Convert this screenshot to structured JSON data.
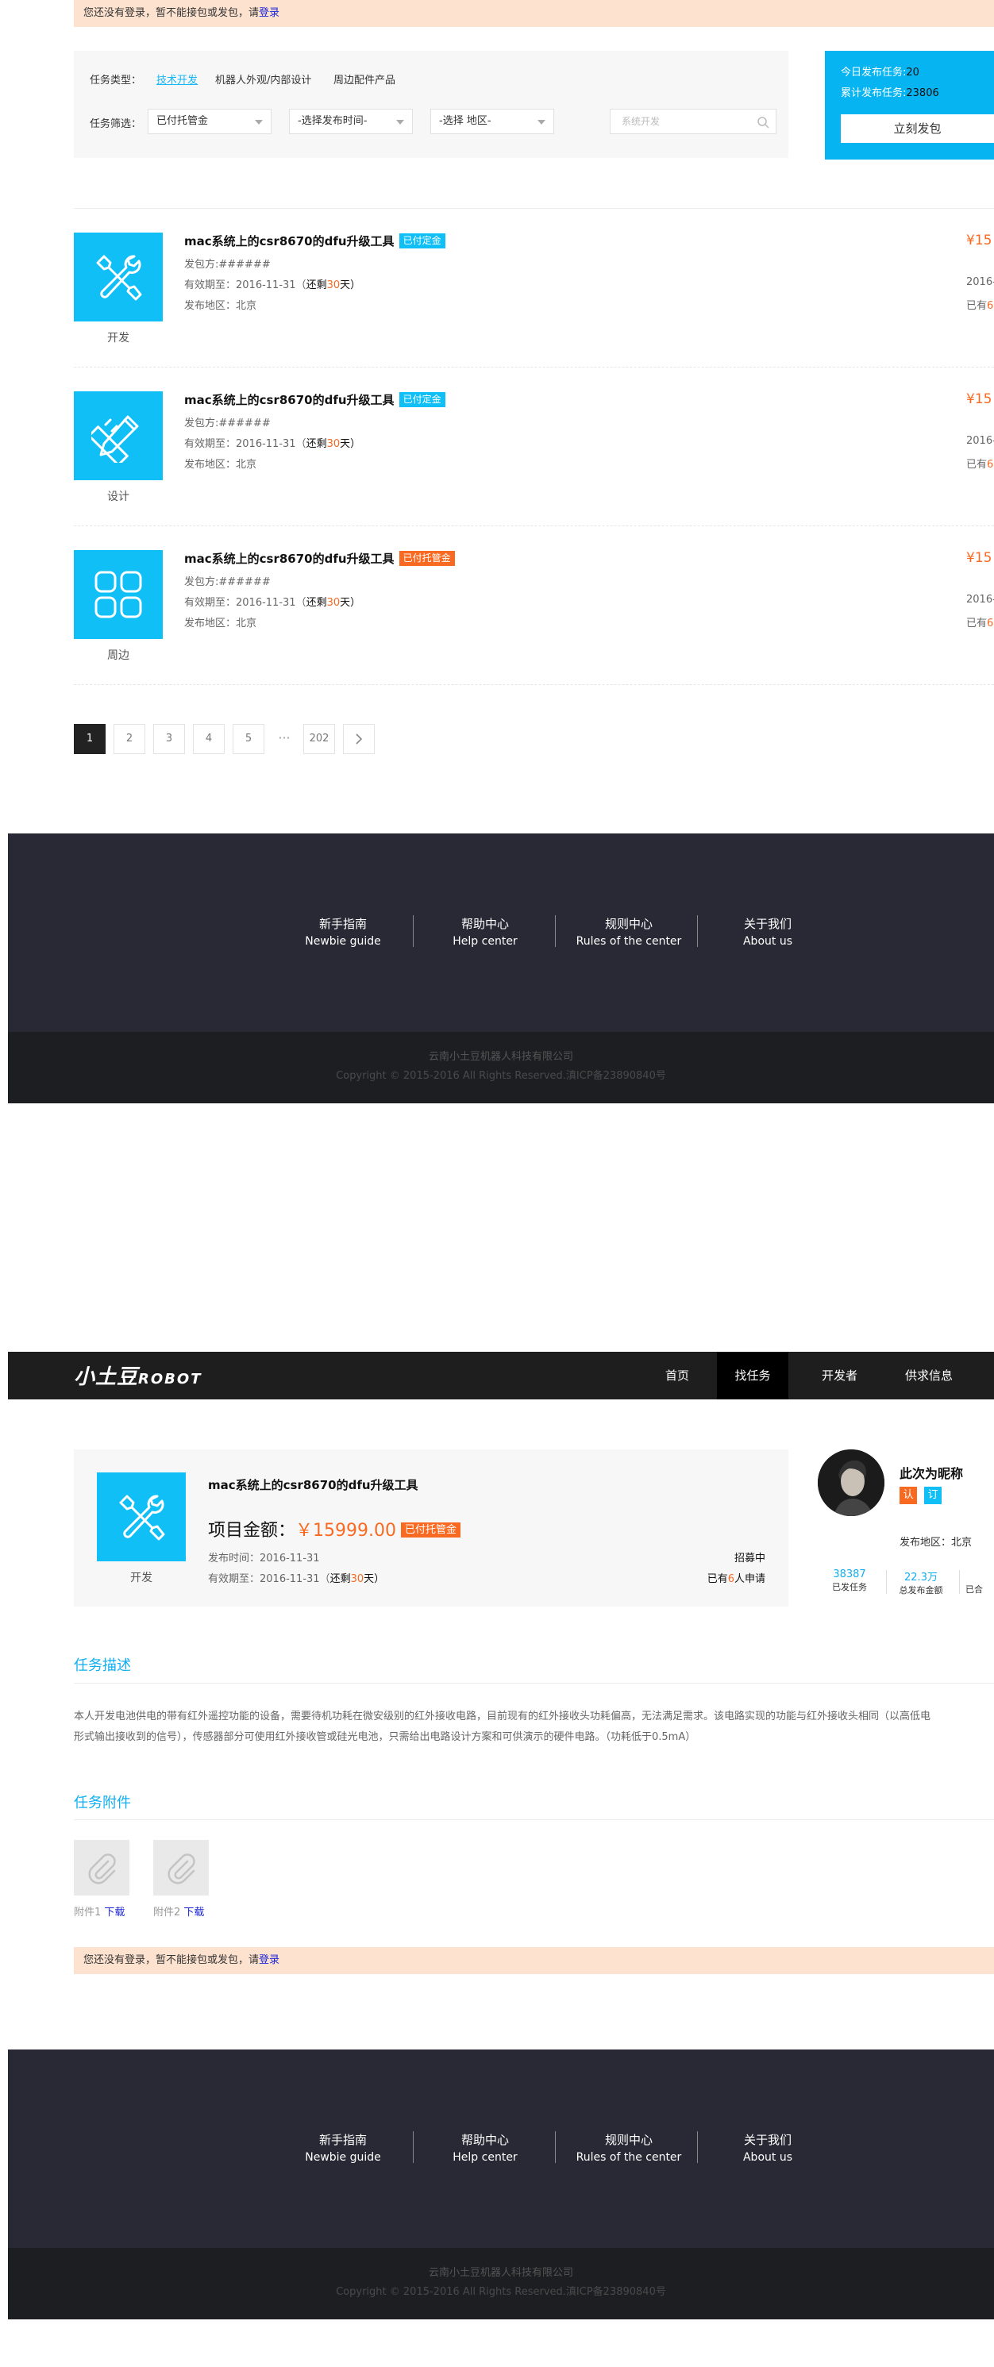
{
  "notice": {
    "text": "您还没有登录，暂不能接包或发包，请",
    "link": "登录"
  },
  "filter": {
    "type_label": "任务类型：",
    "types": [
      "技术开发",
      "机器人外观/内部设计",
      "周边配件产品"
    ],
    "filter_label": "任务筛选：",
    "selects": [
      "已付托管金",
      "-选择发布时间-",
      "-选择 地区-"
    ],
    "search_placeholder": "系统开发"
  },
  "stats": {
    "today_label": "今日发布任务:",
    "today_value": "20",
    "total_label": "累计发布任务:",
    "total_value": "23806",
    "publish_button": "立刻发包"
  },
  "tasks": [
    {
      "icon": "tools-icon",
      "category": "开发",
      "title": "mac系统上的csr8670的dfu升级工具",
      "badge": "已付定金",
      "badge_color": "#10bff5",
      "publisher": "发包方:######",
      "valid_prefix": "有效期至：2016-11-31（",
      "valid_remain": "还剩",
      "valid_days": "30",
      "valid_suffix": "天）",
      "region": "发布地区：北京",
      "price": "¥15",
      "date": "2016-",
      "applied_prefix": "已有",
      "applied_count": "6"
    },
    {
      "icon": "design-icon",
      "category": "设计",
      "title": "mac系统上的csr8670的dfu升级工具",
      "badge": "已付定金",
      "badge_color": "#10bff5",
      "publisher": "发包方:######",
      "valid_prefix": "有效期至：2016-11-31（",
      "valid_remain": "还剩",
      "valid_days": "30",
      "valid_suffix": "天）",
      "region": "发布地区：北京",
      "price": "¥15",
      "date": "2016-",
      "applied_prefix": "已有",
      "applied_count": "6"
    },
    {
      "icon": "grid-icon",
      "category": "周边",
      "title": "mac系统上的csr8670的dfu升级工具",
      "badge": "已付托管金",
      "badge_color": "#f86a22",
      "publisher": "发包方:######",
      "valid_prefix": "有效期至：2016-11-31（",
      "valid_remain": "还剩",
      "valid_days": "30",
      "valid_suffix": "天）",
      "region": "发布地区：北京",
      "price": "¥15",
      "date": "2016-",
      "applied_prefix": "已有",
      "applied_count": "6"
    }
  ],
  "pagination": {
    "pages": [
      "1",
      "2",
      "3",
      "4",
      "5"
    ],
    "dots": "···",
    "last": "202",
    "active": "1"
  },
  "footer": {
    "links": [
      {
        "cn": "新手指南",
        "en": "Newbie guide"
      },
      {
        "cn": "帮助中心",
        "en": "Help center"
      },
      {
        "cn": "规则中心",
        "en": "Rules of the center"
      },
      {
        "cn": "关于我们",
        "en": "About us"
      }
    ],
    "company": "云南小土豆机器人科技有限公司",
    "copyright": "Copyright © 2015-2016  All Rights Reserved.滇ICP备23890840号"
  },
  "nav": {
    "logo_cn": "小土豆",
    "logo_en": "ROBOT",
    "items": [
      "首页",
      "找任务",
      "开发者",
      "供求信息"
    ],
    "active": "找任务"
  },
  "detail": {
    "category": "开发",
    "title": "mac系统上的csr8670的dfu升级工具",
    "amount_label": "项目金额：",
    "amount": "￥15999.00",
    "badge": "已付托管金",
    "publish_time": "发布时间：2016-11-31",
    "valid_prefix": "有效期至：2016-11-31（",
    "valid_remain": "还剩",
    "valid_days": "30",
    "valid_suffix": "天）",
    "status": "招募中",
    "applied_prefix": "已有",
    "applied_count": "6",
    "applied_suffix": "人申请"
  },
  "user": {
    "nickname": "此次为昵称",
    "cert1": "认",
    "cert1_color": "#f86a22",
    "cert2": "订",
    "cert2_color": "#10bff5",
    "region": "发布地区：北京",
    "stats": [
      {
        "value": "38387",
        "label": "已发任务"
      },
      {
        "value": "22.3万",
        "label": "总发布金额"
      },
      {
        "value": "",
        "label": "已合"
      }
    ]
  },
  "description": {
    "title": "任务描述",
    "line1": "本人开发电池供电的带有红外遥控功能的设备，需要待机功耗在微安级别的红外接收电路，目前现有的红外接收头功耗偏高，无法满足需求。该电路实现的功能与红外接收头相同（以高低电",
    "line2": "形式输出接收到的信号），传感器部分可使用红外接收管或硅光电池，只需给出电路设计方案和可供演示的硬件电路。（功耗低于0.5mA）"
  },
  "attachments": {
    "title": "任务附件",
    "items": [
      {
        "name": "附件1",
        "download": "下载"
      },
      {
        "name": "附件2",
        "download": "下载"
      }
    ]
  },
  "notice2": {
    "text": "您还没有登录，暂不能接包或发包，请",
    "link": "登录"
  }
}
